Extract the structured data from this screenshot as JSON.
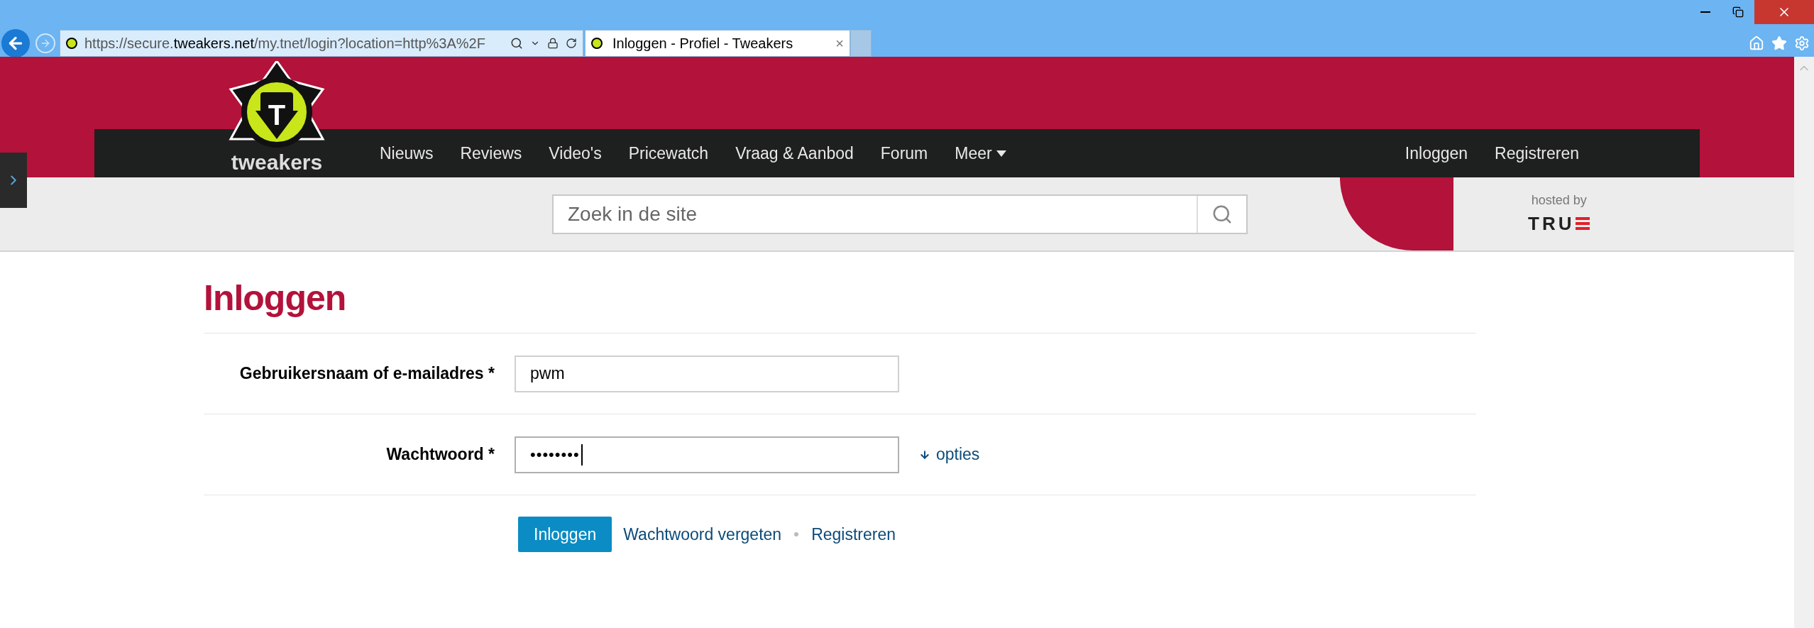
{
  "browser": {
    "url": "https://secure.**tweakers.net**/my.tnet/login?location=http%3A%2F",
    "tab": {
      "title": "Inloggen - Profiel - Tweakers",
      "close": "×"
    }
  },
  "logo": {
    "letter": "T",
    "word": "tweakers"
  },
  "nav": {
    "items": [
      "Nieuws",
      "Reviews",
      "Video's",
      "Pricewatch",
      "Vraag & Aanbod",
      "Forum"
    ],
    "more": "Meer",
    "right": [
      "Inloggen",
      "Registreren"
    ]
  },
  "search": {
    "placeholder": "Zoek in de site"
  },
  "hosted": {
    "label": "hosted by",
    "brand": "TRU"
  },
  "login": {
    "title": "Inloggen",
    "fields": [
      {
        "kind": "text",
        "label": "Gebruikersnaam of e-mailadres *",
        "value": "pwm",
        "focused": false
      },
      {
        "kind": "password",
        "label": "Wachtwoord *",
        "value": "••••••••",
        "focused": true,
        "option": "opties"
      }
    ],
    "submit": "Inloggen",
    "links": [
      "Wachtwoord vergeten",
      "Registreren"
    ]
  }
}
